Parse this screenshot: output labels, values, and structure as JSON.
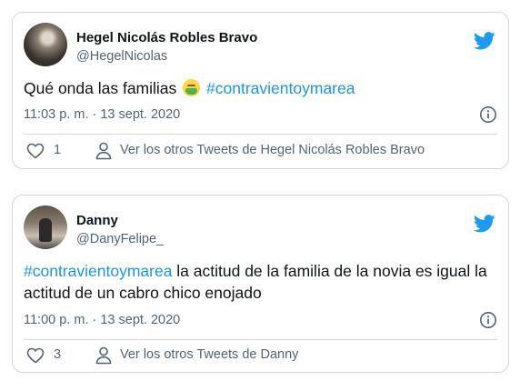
{
  "tweets": [
    {
      "author": "Hegel Nicolás Robles Bravo",
      "handle": "@HegelNicolas",
      "text_before": "Qué onda las familias",
      "emoji": "nauseated-face-emoji",
      "hashtag": "#contravientoymarea",
      "text_after": "",
      "timestamp": "11:03 p. m. · 13 sept. 2020",
      "likes": "1",
      "more_tweets_label": "Ver los otros Tweets de Hegel Nicolás Robles Bravo"
    },
    {
      "author": "Danny",
      "handle": "@DanyFelipe_",
      "hashtag": "#contravientoymarea",
      "text_after": " la actitud de la familia de la novia es igual la actitud de un cabro chico enojado",
      "timestamp": "11:00 p. m. · 13 sept. 2020",
      "likes": "3",
      "more_tweets_label": "Ver los otros Tweets de Danny"
    }
  ],
  "icons": {
    "brand": "twitter-bird-icon",
    "info": "info-icon",
    "like": "heart-icon",
    "profile": "person-icon"
  },
  "colors": {
    "brand_blue": "#1d9bf0",
    "hashtag_blue": "#1b95e0",
    "secondary_text": "#536471",
    "border": "#cfd9de"
  }
}
